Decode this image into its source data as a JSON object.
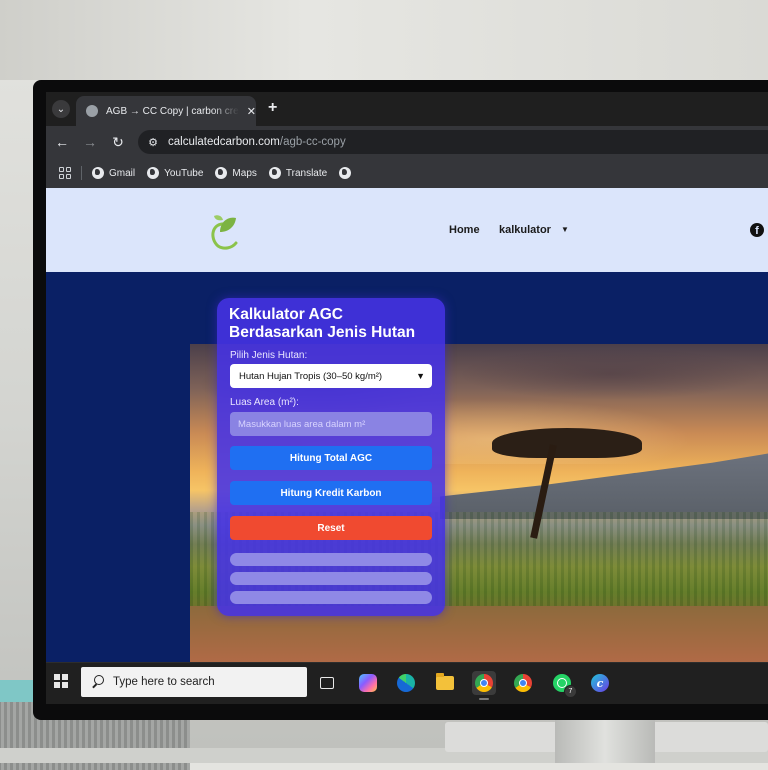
{
  "browser": {
    "tab_title": "AGB → CC Copy | carbon credit",
    "tab_close": "✕",
    "new_tab": "+",
    "url_host": "calculatedcarbon.com",
    "url_path": "/agb-cc-copy",
    "bookmarks": [
      {
        "label": "Gmail"
      },
      {
        "label": "YouTube"
      },
      {
        "label": "Maps"
      },
      {
        "label": "Translate"
      },
      {
        "label": ""
      }
    ]
  },
  "site": {
    "nav": {
      "home": "Home",
      "calculator": "kalkulator"
    },
    "facebook_glyph": "f"
  },
  "calculator": {
    "title": "Kalkulator AGC Berdasarkan Jenis Hutan",
    "forest_type_label": "Pilih Jenis Hutan:",
    "forest_type_selected": "Hutan Hujan Tropis (30–50 kg/m²)",
    "area_label": "Luas Area (m²):",
    "area_placeholder": "Masukkan luas area dalam m²",
    "area_value": "",
    "btn_total_agc": "Hitung Total AGC",
    "btn_carbon_credit": "Hitung Kredit Karbon",
    "btn_reset": "Reset"
  },
  "taskbar": {
    "search_placeholder": "Type here to search",
    "whatsapp_badge": "7",
    "apps": [
      "task-view",
      "copilot",
      "edge",
      "file-explorer",
      "chrome-profile",
      "chrome",
      "whatsapp",
      "canva"
    ]
  },
  "colors": {
    "card": "#4632E6",
    "primary_button": "#1F6FF2",
    "reset_button": "#F04A30",
    "header": "#DBE5FB",
    "page_bg": "#0A2065"
  }
}
